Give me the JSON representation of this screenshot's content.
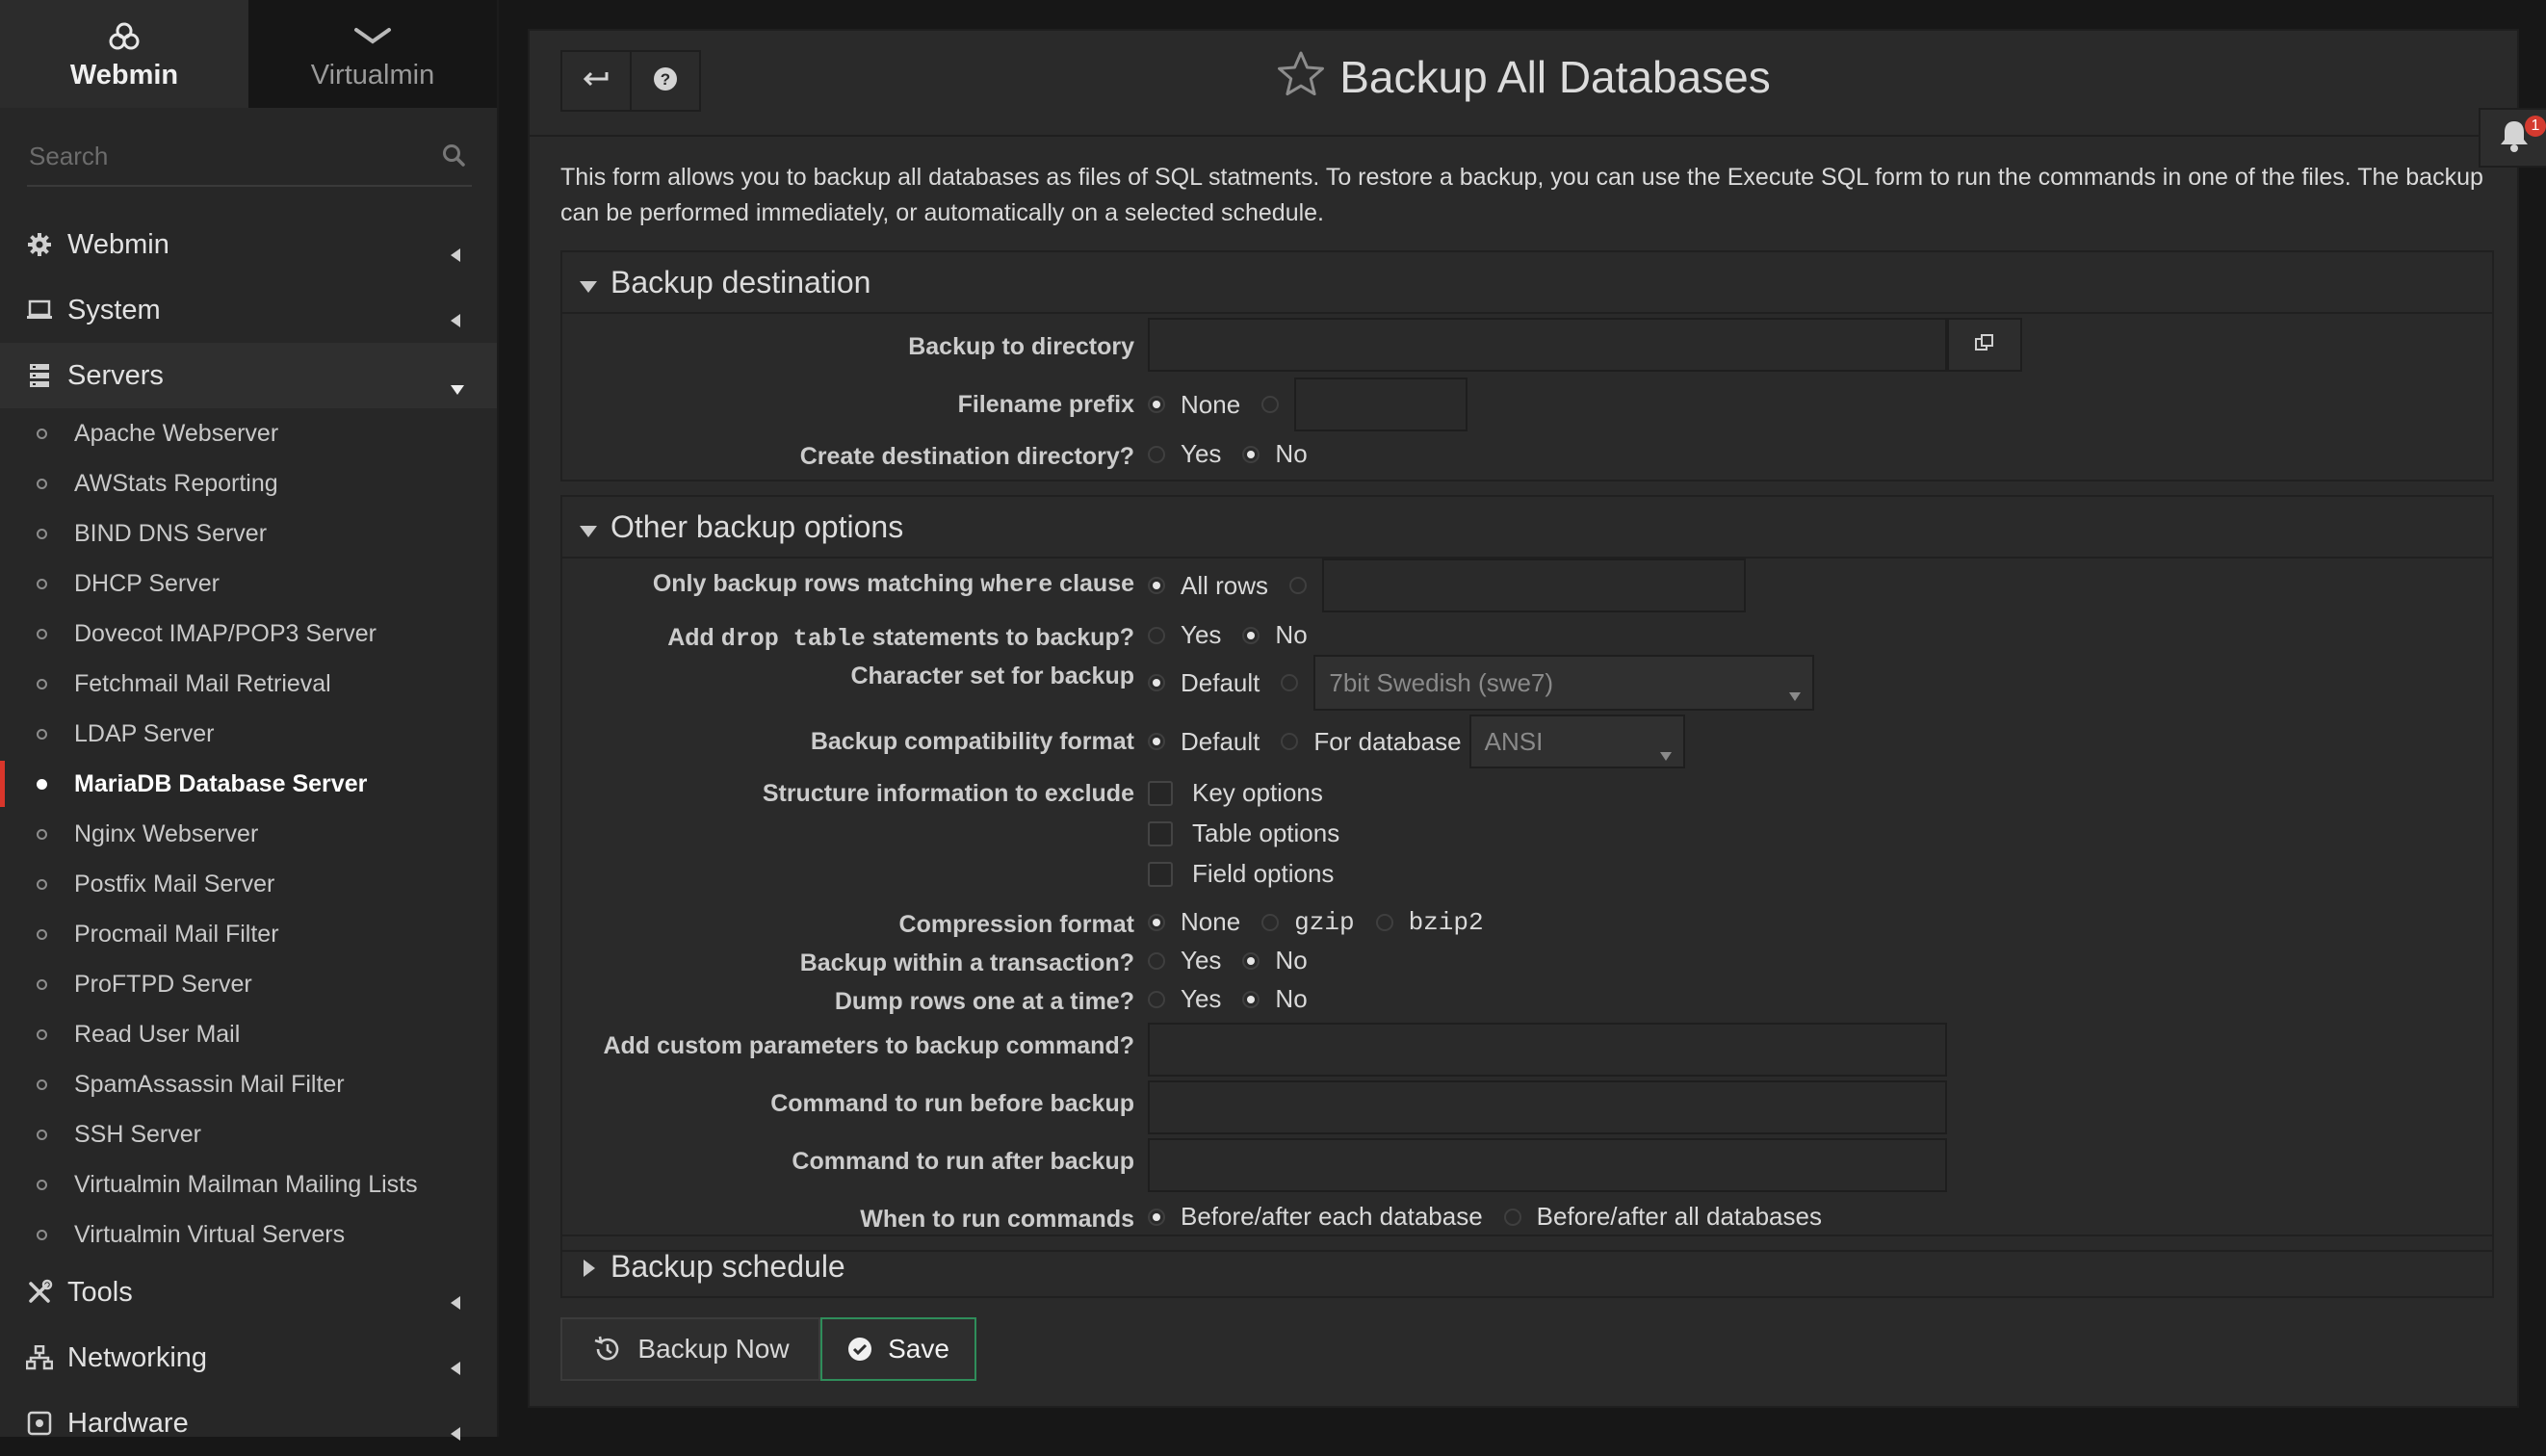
{
  "switcher": {
    "webmin": "Webmin",
    "virtualmin": "Virtualmin"
  },
  "search": {
    "placeholder": "Search"
  },
  "nav": {
    "webmin": "Webmin",
    "system": "System",
    "servers": "Servers",
    "server_items": [
      "Apache Webserver",
      "AWStats Reporting",
      "BIND DNS Server",
      "DHCP Server",
      "Dovecot IMAP/POP3 Server",
      "Fetchmail Mail Retrieval",
      "LDAP Server",
      "MariaDB Database Server",
      "Nginx Webserver",
      "Postfix Mail Server",
      "Procmail Mail Filter",
      "ProFTPD Server",
      "Read User Mail",
      "SpamAssassin Mail Filter",
      "SSH Server",
      "Virtualmin Mailman Mailing Lists",
      "Virtualmin Virtual Servers"
    ],
    "tools": "Tools",
    "networking": "Networking",
    "hardware": "Hardware"
  },
  "page": {
    "title": "Backup All Databases",
    "intro": "This form allows you to backup all databases as files of SQL statments. To restore a backup, you can use the Execute SQL form to run the commands in one of the files. The backup can be performed immediately, or automatically on a selected schedule."
  },
  "notifications": {
    "count": "1"
  },
  "destination": {
    "heading": "Backup destination",
    "dir_label": "Backup to directory",
    "dir_value": "",
    "prefix_label": "Filename prefix",
    "prefix_none": "None",
    "create_label": "Create destination directory?",
    "yes": "Yes",
    "no": "No"
  },
  "options": {
    "heading": "Other backup options",
    "where_label_pre": "Only backup rows matching ",
    "where_label_code": "where",
    "where_label_post": " clause",
    "all_rows": "All rows",
    "drop_label_pre": "Add ",
    "drop_label_code": "drop table",
    "drop_label_post": " statements to backup?",
    "charset_label": "Character set for backup",
    "default": "Default",
    "charset_select": "7bit Swedish (swe7)",
    "compat_label": "Backup compatibility format",
    "for_database": "For database",
    "compat_select": "ANSI",
    "exclude_label": "Structure information to exclude",
    "key_options": "Key options",
    "table_options": "Table options",
    "field_options": "Field options",
    "compression_label": "Compression format",
    "comp_none": "None",
    "comp_gzip": "gzip",
    "comp_bzip2": "bzip2",
    "transaction_label": "Backup within a transaction?",
    "dump_label": "Dump rows one at a time?",
    "yes": "Yes",
    "no": "No",
    "custom_label": "Add custom parameters to backup command?",
    "before_label": "Command to run before backup",
    "after_label": "Command to run after backup",
    "when_label": "When to run commands",
    "when_each": "Before/after each database",
    "when_all": "Before/after all databases"
  },
  "schedule": {
    "heading": "Backup schedule"
  },
  "buttons": {
    "backup_now": "Backup Now",
    "save": "Save"
  }
}
